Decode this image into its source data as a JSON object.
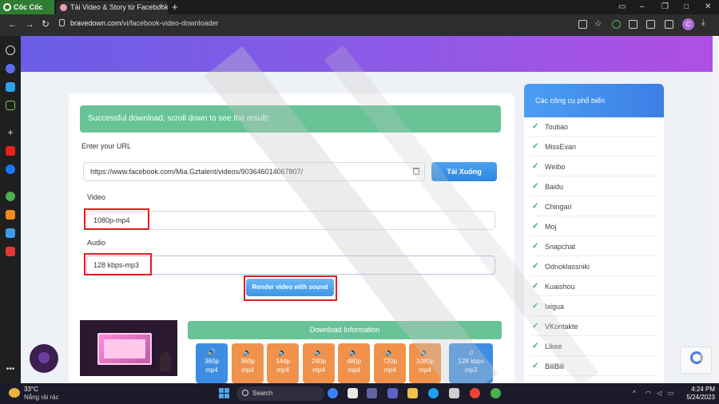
{
  "browser": {
    "brand": "Cốc Cốc",
    "tab_title": "Tải Video & Story từ Facebook",
    "tab_close": "×",
    "new_tab": "+",
    "url_host": "bravedown.com",
    "url_path": "/vi/facebook-video-downloader",
    "avatar_letter": "C"
  },
  "main": {
    "alert": "Successful download, scroll down to see the result!",
    "url_label": "Enter your URL",
    "url_value": "https://www.facebook.com/Mia.Gztalent/videos/903646014067807/",
    "download_button": "Tải Xuống",
    "video_label": "Video",
    "video_value": "1080p-mp4",
    "audio_label": "Audio",
    "audio_value": "128 kbps-mp3",
    "render_button": "Render video with sound",
    "download_info": "Download Information",
    "qualities": [
      {
        "res": "360p",
        "fmt": "mp4"
      },
      {
        "res": "360p",
        "fmt": "mp4"
      },
      {
        "res": "144p",
        "fmt": "mp4"
      },
      {
        "res": "240p",
        "fmt": "mp4"
      },
      {
        "res": "480p",
        "fmt": "mp4"
      },
      {
        "res": "720p",
        "fmt": "mp4"
      },
      {
        "res": "1080p",
        "fmt": "mp4"
      },
      {
        "res": "128 kbps",
        "fmt": "mp3"
      }
    ]
  },
  "tools": {
    "title": "Các công cụ phổ biến",
    "items": [
      "Toutiao",
      "MissEvan",
      "Weibo",
      "Baidu",
      "Chingari",
      "Moj",
      "Snapchat",
      "Odnoklassniki",
      "Kuaishou",
      "Ixigua",
      "VKontakte",
      "Likee",
      "BiliBili"
    ]
  },
  "taskbar": {
    "temp": "33°C",
    "condition": "Nắng rải rác",
    "search": "Search",
    "time": "4:24 PM",
    "date": "5/24/2023"
  },
  "colors": {
    "alert_green": "#68c497",
    "primary_blue": "#3d8ee2",
    "quality_orange": "#f0924c",
    "highlight_red": "#e01e1e"
  }
}
